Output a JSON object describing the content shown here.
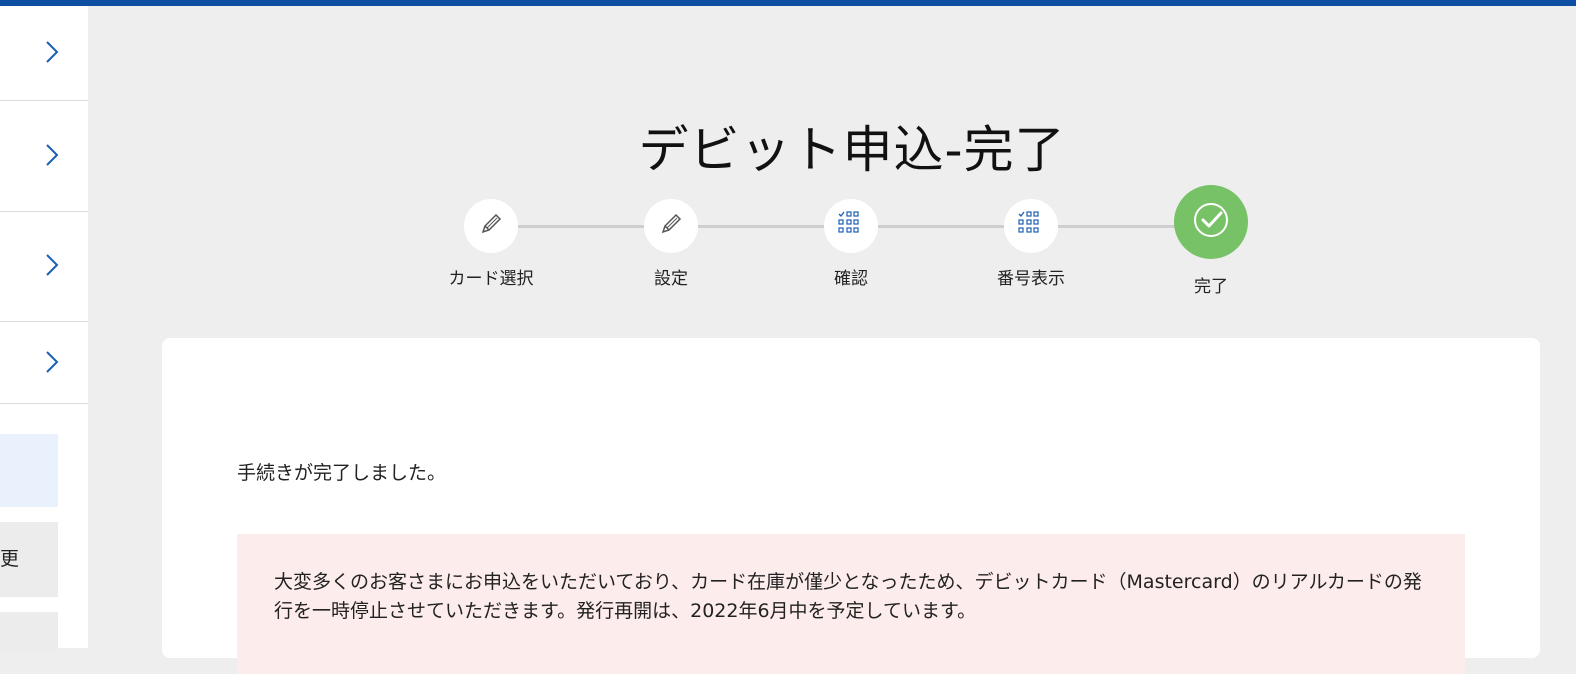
{
  "page": {
    "title": "デビット申込-完了"
  },
  "sidebar": {
    "items": [
      {
        "icon": "chevron-right-icon"
      },
      {
        "icon": "chevron-right-icon"
      },
      {
        "icon": "chevron-right-icon"
      },
      {
        "icon": "chevron-right-icon"
      }
    ],
    "partial_label": "更"
  },
  "steps": [
    {
      "label": "カード選択",
      "icon": "pencil-icon",
      "state": "completed"
    },
    {
      "label": "設定",
      "icon": "pencil-icon",
      "state": "completed"
    },
    {
      "label": "確認",
      "icon": "checklist-grid-icon",
      "state": "completed"
    },
    {
      "label": "番号表示",
      "icon": "checklist-grid-icon",
      "state": "completed"
    },
    {
      "label": "完了",
      "icon": "check-circle-icon",
      "state": "current"
    }
  ],
  "main": {
    "complete_message": "手続きが完了しました。",
    "notice_text": "大変多くのお客さまにお申込をいただいており、カード在庫が僅少となったため、デビットカード（Mastercard）のリアルカードの発行を一時停止させていただきます。発行再開は、2022年6月中を予定しています。"
  },
  "colors": {
    "top_bar": "#0e4fa3",
    "accent_blue": "#1b5fb3",
    "complete_green": "#77c266",
    "notice_bg": "#fdecec",
    "page_bg": "#eeeeee"
  }
}
